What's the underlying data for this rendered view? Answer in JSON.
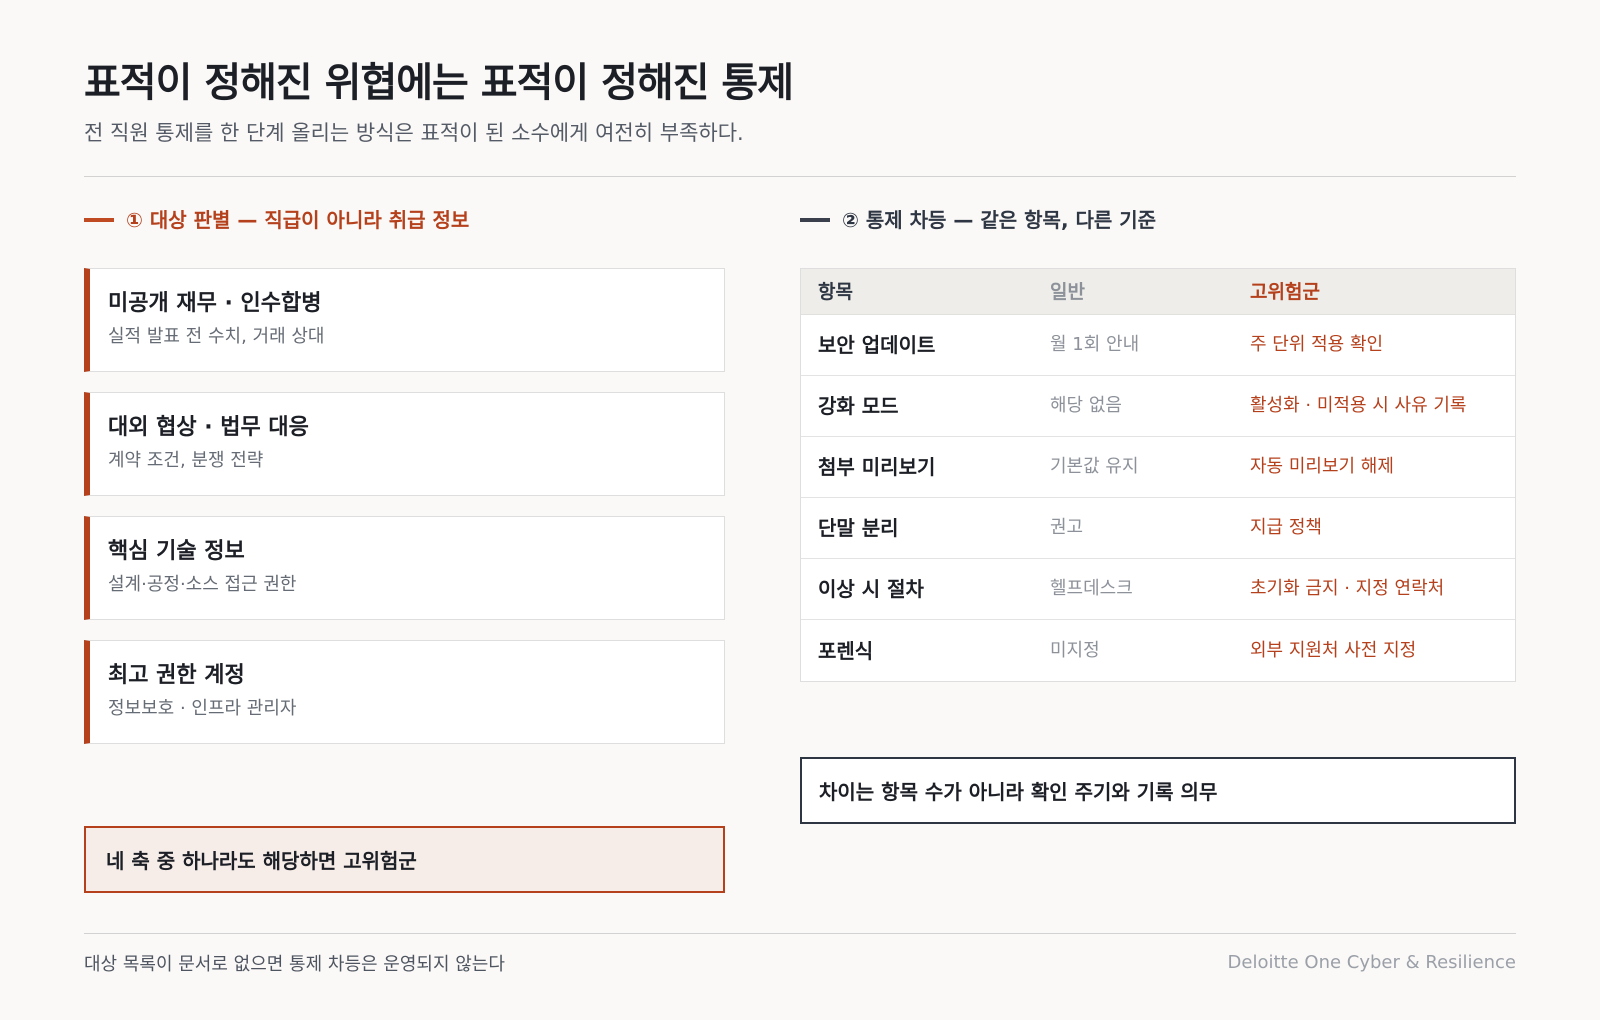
{
  "header": {
    "title": "표적이 정해진 위협에는 표적이 정해진 통제",
    "subtitle": "전 직원 통제를 한 단계 올리는 방식은 표적이 된 소수에게 여전히 부족하다."
  },
  "left_section": {
    "heading": "① 대상 판별 — 직급이 아니라 취급 정보",
    "cards": [
      {
        "title": "미공개 재무 · 인수합병",
        "desc": "실적 발표 전 수치, 거래 상대"
      },
      {
        "title": "대외 협상 · 법무 대응",
        "desc": "계약 조건, 분쟁 전략"
      },
      {
        "title": "핵심 기술 정보",
        "desc": "설계·공정·소스 접근 권한"
      },
      {
        "title": "최고 권한 계정",
        "desc": "정보보호 · 인프라 관리자"
      }
    ],
    "callout": "네 축 중 하나라도 해당하면 고위험군"
  },
  "right_section": {
    "heading": "② 통제 차등 — 같은 항목, 다른 기준",
    "table": {
      "columns": [
        "항목",
        "일반",
        "고위험군"
      ],
      "rows": [
        {
          "item": "보안 업데이트",
          "general": "월 1회 안내",
          "high_risk": "주 단위 적용 확인"
        },
        {
          "item": "강화 모드",
          "general": "해당 없음",
          "high_risk": "활성화 · 미적용 시 사유 기록"
        },
        {
          "item": "첨부 미리보기",
          "general": "기본값 유지",
          "high_risk": "자동 미리보기 해제"
        },
        {
          "item": "단말 분리",
          "general": "권고",
          "high_risk": "지급 정책"
        },
        {
          "item": "이상 시 절차",
          "general": "헬프데스크",
          "high_risk": "초기화 금지 · 지정 연락처"
        },
        {
          "item": "포렌식",
          "general": "미지정",
          "high_risk": "외부 지원처 사전 지정"
        }
      ]
    },
    "callout": "차이는 항목 수가 아니라 확인 주기와 기록 의무"
  },
  "footer": {
    "note": "대상 목록이 문서로 없으면 통제 차등은 운영되지 않는다",
    "brand": "Deloitte One Cyber & Resilience"
  },
  "colors": {
    "accent": "#b5401c",
    "dark": "#2f3643",
    "background": "#faf9f7"
  }
}
